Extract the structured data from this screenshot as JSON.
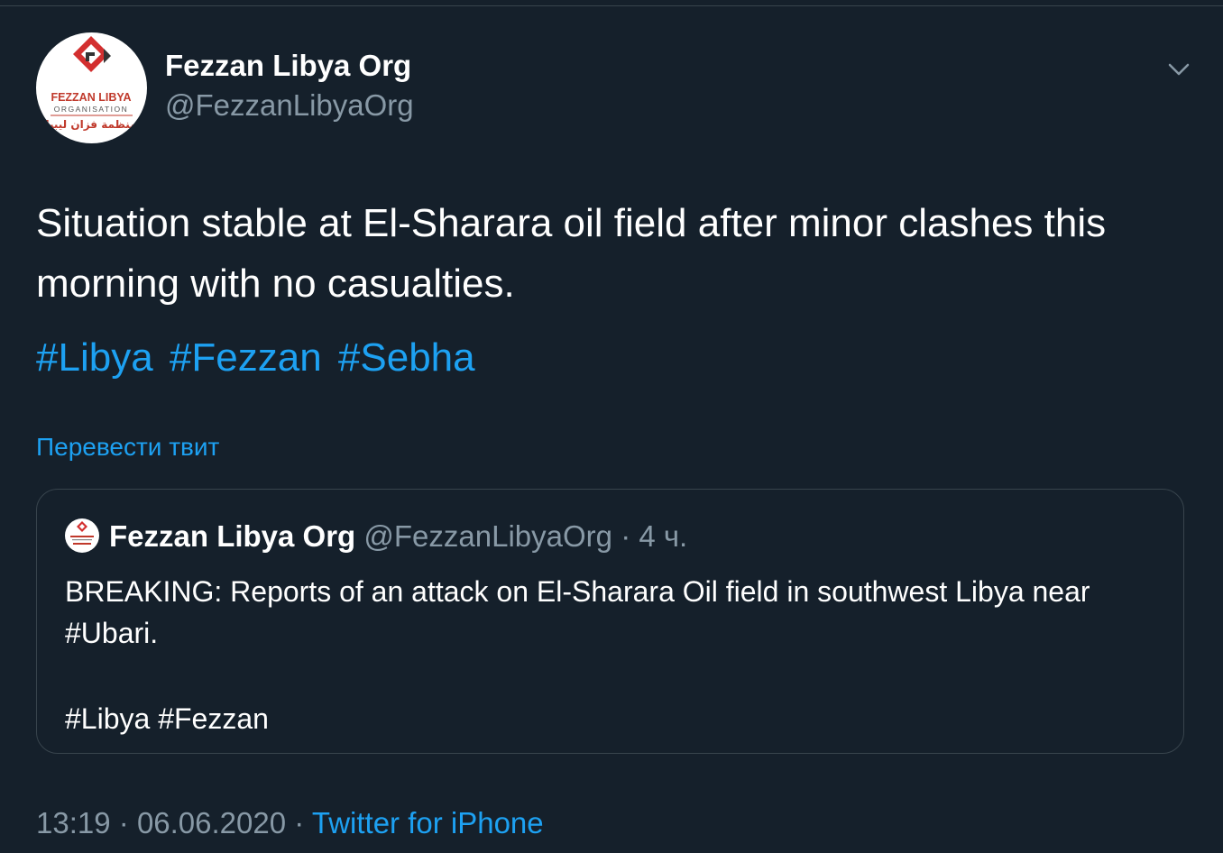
{
  "author": {
    "name": "Fezzan Libya Org",
    "handle": "@FezzanLibyaOrg",
    "avatar_text_top": "FEZZAN LIBYA",
    "avatar_text_mid": "ORGANISATION",
    "avatar_text_arabic": "منظمة فزان ليبيا"
  },
  "tweet": {
    "text": "Situation stable at El-Sharara oil field after minor clashes this morning with no casualties.",
    "hashtags": [
      "#Libya",
      "#Fezzan",
      "#Sebha"
    ],
    "translate_label": "Перевести твит"
  },
  "quoted_tweet": {
    "name": "Fezzan Libya Org",
    "handle": "@FezzanLibyaOrg",
    "time": "· 4 ч.",
    "text": "BREAKING: Reports of an attack on El-Sharara Oil field in southwest Libya near #Ubari.",
    "tags": "#Libya #Fezzan"
  },
  "footer": {
    "time": "13:19",
    "separator": "·",
    "date": "06.06.2020",
    "source": "Twitter for iPhone"
  },
  "colors": {
    "background": "#15202b",
    "link": "#1da1f2",
    "secondary_text": "#8899a6",
    "border": "#38444d",
    "brand_red": "#d32f2f"
  },
  "icons": {
    "menu": "chevron-down-icon"
  }
}
